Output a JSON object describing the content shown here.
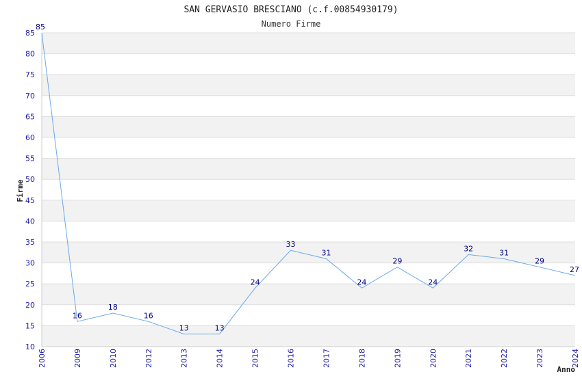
{
  "chart_data": {
    "type": "line",
    "title": "SAN GERVASIO BRESCIANO (c.f.00854930179)",
    "subtitle": "Numero Firme",
    "ylabel": "Firme",
    "xlabel": "Anno",
    "ylim": [
      10,
      85
    ],
    "yticks": [
      10,
      15,
      20,
      25,
      30,
      35,
      40,
      45,
      50,
      55,
      60,
      65,
      70,
      75,
      80,
      85
    ],
    "grid": true,
    "categories": [
      "2006",
      "2009",
      "2010",
      "2012",
      "2013",
      "2014",
      "2015",
      "2016",
      "2017",
      "2018",
      "2019",
      "2020",
      "2021",
      "2022",
      "2023",
      "2024"
    ],
    "series": [
      {
        "values": [
          85,
          16,
          18,
          16,
          13,
          13,
          24,
          33,
          31,
          24,
          29,
          24,
          32,
          31,
          29,
          27
        ]
      }
    ],
    "colors": {
      "line": "#6aa8e8",
      "band": "#f2f2f2",
      "grid": "#dddddd",
      "tick_text": "#1a1aaa",
      "label_text": "#000080"
    }
  }
}
